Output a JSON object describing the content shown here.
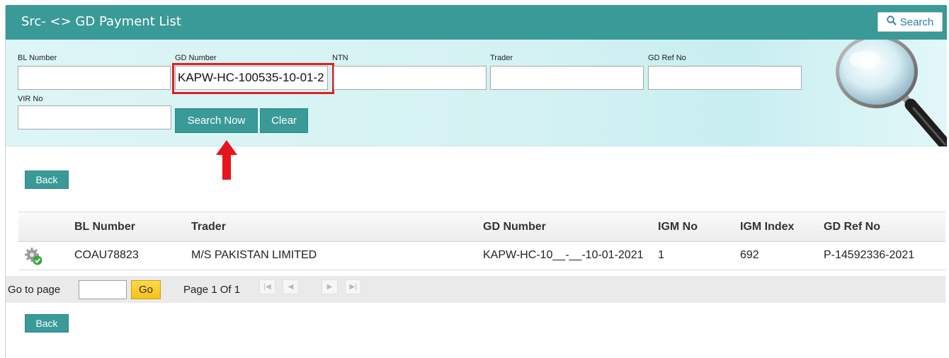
{
  "title": "Src- <> GD Payment List",
  "search_button": "Search",
  "filters": {
    "bl_number": {
      "label": "BL Number",
      "value": ""
    },
    "gd_number": {
      "label": "GD Number",
      "value": "KAPW-HC-100535-10-01-2"
    },
    "ntn": {
      "label": "NTN",
      "value": ""
    },
    "trader": {
      "label": "Trader",
      "value": ""
    },
    "gd_ref_no": {
      "label": "GD Ref No",
      "value": ""
    },
    "vir_no": {
      "label": "VIR No",
      "value": ""
    }
  },
  "search_now_label": "Search Now",
  "clear_label": "Clear",
  "back_label": "Back",
  "table": {
    "columns": [
      "BL Number",
      "Trader",
      "GD Number",
      "IGM No",
      "IGM Index",
      "GD Ref No"
    ],
    "rows": [
      {
        "bl_number": "COAU78823",
        "trader": "M/S PAKISTAN LIMITED",
        "gd_number": "KAPW-HC-10__-__-10-01-2021",
        "igm_no": "1",
        "igm_index": "692",
        "gd_ref_no": "P-14592336-2021"
      }
    ]
  },
  "pager": {
    "go_to_page_label": "Go to page",
    "page_input": "",
    "go_label": "Go",
    "page_info": "Page 1 Of 1",
    "nav_icons": [
      "first-page-icon",
      "prev-page-icon",
      "next-page-icon",
      "last-page-icon"
    ]
  },
  "colors": {
    "header_teal": "#3a9a98",
    "filter_bg": "#d4f2f3",
    "go_button": "#f7c21a",
    "highlight": "#e02020"
  }
}
